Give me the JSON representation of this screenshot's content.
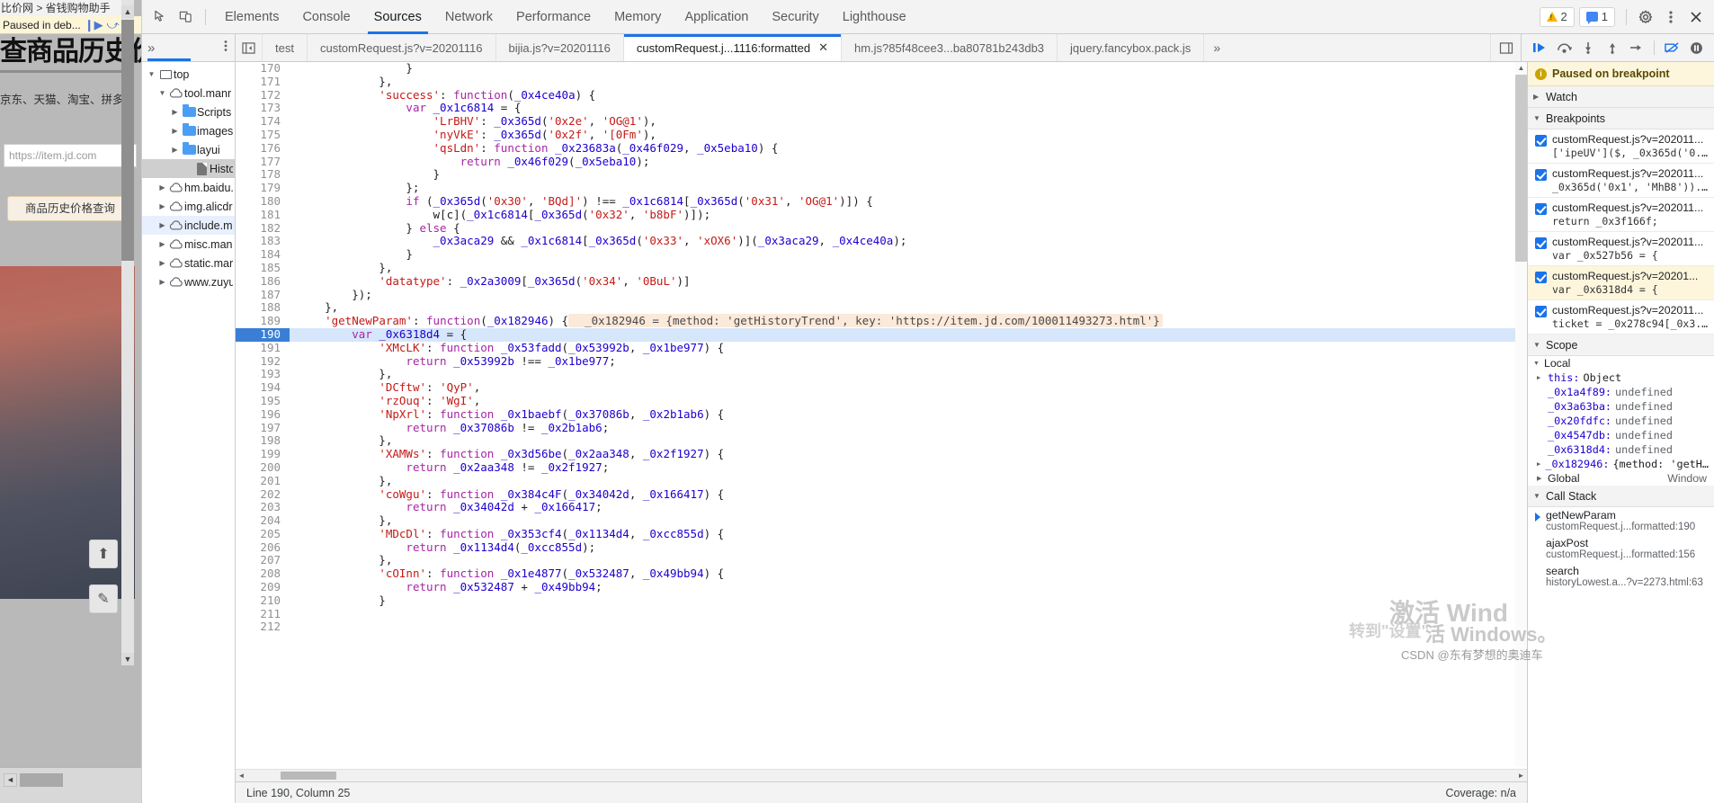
{
  "webpage": {
    "breadcrumb": "比价网 > 省钱购物助手",
    "paused_label": "Paused in deb...",
    "resume_icon": "resume-icon",
    "step_icon": "step-over-icon",
    "title": "查商品历史价",
    "subtitle": "京东、天猫、淘宝、拼多",
    "search_placeholder": "https://item.jd.com",
    "query_button": "商品历史价格查询",
    "scroll_up": "▲",
    "scroll_down": "▼",
    "hscroll_left": "◄",
    "hscroll_right": "►",
    "back_to_top_icon": "arrow-up-icon",
    "edit_icon": "pencil-icon"
  },
  "toolbar": {
    "inspect_icon": "inspect-element-icon",
    "device_icon": "device-toolbar-icon",
    "panels": [
      {
        "label": "Elements",
        "active": false
      },
      {
        "label": "Console",
        "active": false
      },
      {
        "label": "Sources",
        "active": true
      },
      {
        "label": "Network",
        "active": false
      },
      {
        "label": "Performance",
        "active": false
      },
      {
        "label": "Memory",
        "active": false
      },
      {
        "label": "Application",
        "active": false
      },
      {
        "label": "Security",
        "active": false
      },
      {
        "label": "Lighthouse",
        "active": false
      }
    ],
    "warning_count": "2",
    "message_count": "1",
    "settings_icon": "gear-icon",
    "more_icon": "kebab-menu-icon",
    "close_icon": "close-icon"
  },
  "filetabs": {
    "more_icon": "chevrons-right-icon",
    "kebab_icon": "kebab-menu-icon",
    "panel_toggle_icon": "show-navigator-icon",
    "tabs": [
      {
        "label": "test",
        "active": false,
        "closable": false
      },
      {
        "label": "customRequest.js?v=20201116",
        "active": false,
        "closable": false
      },
      {
        "label": "bijia.js?v=20201116",
        "active": false,
        "closable": false
      },
      {
        "label": "customRequest.j...1116:formatted",
        "active": true,
        "closable": true
      },
      {
        "label": "hm.js?85f48cee3...ba80781b243db3",
        "active": false,
        "closable": false
      },
      {
        "label": "jquery.fancybox.pack.js",
        "active": false,
        "closable": false
      }
    ],
    "overflow_icon": "chevrons-right-icon",
    "dock_icon": "dock-side-icon",
    "close_label": "✕"
  },
  "debug_controls": [
    {
      "name": "resume-script-execution",
      "glyph": "▶",
      "accent": true
    },
    {
      "name": "step-over-next-call",
      "glyph": "↷",
      "accent": false
    },
    {
      "name": "step-into-next-call",
      "glyph": "↓",
      "accent": false
    },
    {
      "name": "step-out-of-function",
      "glyph": "↑",
      "accent": false
    },
    {
      "name": "step",
      "glyph": "⇥",
      "accent": false
    },
    {
      "name": "deactivate-breakpoints",
      "glyph": "⤮",
      "accent": false
    },
    {
      "name": "pause-on-exceptions",
      "glyph": "⏸",
      "accent": false
    }
  ],
  "navigator": {
    "tree": [
      {
        "label": "top",
        "indent": 0,
        "twisty": "open",
        "icon": "frame",
        "state": ""
      },
      {
        "label": "tool.manr",
        "indent": 1,
        "twisty": "open",
        "icon": "cloud",
        "state": ""
      },
      {
        "label": "Scripts",
        "indent": 2,
        "twisty": "closed",
        "icon": "folder",
        "state": ""
      },
      {
        "label": "images",
        "indent": 2,
        "twisty": "closed",
        "icon": "folder",
        "state": ""
      },
      {
        "label": "layui",
        "indent": 2,
        "twisty": "closed",
        "icon": "folder",
        "state": ""
      },
      {
        "label": "History",
        "indent": 3,
        "twisty": "none",
        "icon": "file",
        "state": "selected"
      },
      {
        "label": "hm.baidu.",
        "indent": 1,
        "twisty": "closed",
        "icon": "cloud",
        "state": ""
      },
      {
        "label": "img.alicdr",
        "indent": 1,
        "twisty": "closed",
        "icon": "cloud",
        "state": ""
      },
      {
        "label": "include.m",
        "indent": 1,
        "twisty": "closed",
        "icon": "cloud",
        "state": "hl"
      },
      {
        "label": "misc.man",
        "indent": 1,
        "twisty": "closed",
        "icon": "cloud",
        "state": ""
      },
      {
        "label": "static.mar",
        "indent": 1,
        "twisty": "closed",
        "icon": "cloud",
        "state": ""
      },
      {
        "label": "www.zuyu",
        "indent": 1,
        "twisty": "closed",
        "icon": "cloud",
        "state": ""
      }
    ]
  },
  "editor": {
    "lines": [
      {
        "n": "170",
        "code": "                }"
      },
      {
        "n": "171",
        "code": "            },"
      },
      {
        "n": "172",
        "code": "            'success': function(_0x4ce40a) {"
      },
      {
        "n": "173",
        "code": "                var _0x1c6814 = {"
      },
      {
        "n": "174",
        "code": "                    'LrBHV': _0x365d('0x2e', 'OG@1'),"
      },
      {
        "n": "175",
        "code": "                    'nyVkE': _0x365d('0x2f', '[0Fm'),"
      },
      {
        "n": "176",
        "code": "                    'qsLdn': function _0x23683a(_0x46f029, _0x5eba10) {"
      },
      {
        "n": "177",
        "code": "                        return _0x46f029(_0x5eba10);"
      },
      {
        "n": "178",
        "code": "                    }"
      },
      {
        "n": "179",
        "code": "                };"
      },
      {
        "n": "180",
        "code": "                if (_0x365d('0x30', 'BQd]') !== _0x1c6814[_0x365d('0x31', 'OG@1')]) {"
      },
      {
        "n": "181",
        "code": "                    w[c](_0x1c6814[_0x365d('0x32', 'b8bF')]);"
      },
      {
        "n": "182",
        "code": "                } else {"
      },
      {
        "n": "183",
        "code": "                    _0x3aca29 && _0x1c6814[_0x365d('0x33', 'xOX6')](_0x3aca29, _0x4ce40a);"
      },
      {
        "n": "184",
        "code": "                }"
      },
      {
        "n": "185",
        "code": "            },"
      },
      {
        "n": "186",
        "code": "            'datatype': _0x2a3009[_0x365d('0x34', '0BuL')]"
      },
      {
        "n": "187",
        "code": "        });"
      },
      {
        "n": "188",
        "code": "    },"
      },
      {
        "n": "189",
        "code": "    'getNewParam': function(_0x182946) {",
        "inline_eval": "_0x182946 = {method: 'getHistoryTrend', key: 'https://item.jd.com/100011493273.html'}"
      },
      {
        "n": "190",
        "code": "        var _0x6318d4 = {",
        "executing": true
      },
      {
        "n": "191",
        "code": "            'XMcLK': function _0x53fadd(_0x53992b, _0x1be977) {"
      },
      {
        "n": "192",
        "code": "                return _0x53992b !== _0x1be977;"
      },
      {
        "n": "193",
        "code": "            },"
      },
      {
        "n": "194",
        "code": "            'DCftw': 'QyP',"
      },
      {
        "n": "195",
        "code": "            'rzOuq': 'WgI',"
      },
      {
        "n": "196",
        "code": "            'NpXrl': function _0x1baebf(_0x37086b, _0x2b1ab6) {"
      },
      {
        "n": "197",
        "code": "                return _0x37086b != _0x2b1ab6;"
      },
      {
        "n": "198",
        "code": "            },"
      },
      {
        "n": "199",
        "code": "            'XAMWs': function _0x3d56be(_0x2aa348, _0x2f1927) {"
      },
      {
        "n": "200",
        "code": "                return _0x2aa348 != _0x2f1927;"
      },
      {
        "n": "201",
        "code": "            },"
      },
      {
        "n": "202",
        "code": "            'coWgu': function _0x384c4F(_0x34042d, _0x166417) {"
      },
      {
        "n": "203",
        "code": "                return _0x34042d + _0x166417;"
      },
      {
        "n": "204",
        "code": "            },"
      },
      {
        "n": "205",
        "code": "            'MDcDl': function _0x353cf4(_0x1134d4, _0xcc855d) {"
      },
      {
        "n": "206",
        "code": "                return _0x1134d4(_0xcc855d);"
      },
      {
        "n": "207",
        "code": "            },"
      },
      {
        "n": "208",
        "code": "            'cOInn': function _0x1e4877(_0x532487, _0x49bb94) {"
      },
      {
        "n": "209",
        "code": "                return _0x532487 + _0x49bb94;"
      },
      {
        "n": "210",
        "code": "            }"
      },
      {
        "n": "211",
        "code": ""
      },
      {
        "n": "212",
        "code": ""
      }
    ],
    "status_left": "Line 190, Column 25",
    "status_right": "Coverage: n/a"
  },
  "debugger": {
    "paused_banner": "Paused on breakpoint",
    "info_glyph": "i",
    "watch_label": "Watch",
    "breakpoints_label": "Breakpoints",
    "breakpoints": [
      {
        "file": "customRequest.js?v=202011...",
        "code": "['ipeUV']($, _0x365d('0...",
        "checked": true,
        "active": false
      },
      {
        "file": "customRequest.js?v=202011...",
        "code": "_0x365d('0x1', 'MhB8'))...",
        "checked": true,
        "active": false
      },
      {
        "file": "customRequest.js?v=202011...",
        "code": "return _0x3f166f;",
        "checked": true,
        "active": false
      },
      {
        "file": "customRequest.js?v=202011...",
        "code": "var _0x527b56 = {",
        "checked": true,
        "active": false
      },
      {
        "file": "customRequest.js?v=20201...",
        "code": "var _0x6318d4 = {",
        "checked": true,
        "active": true
      },
      {
        "file": "customRequest.js?v=202011...",
        "code": "ticket = _0x278c94[_0x3...",
        "checked": true,
        "active": false
      }
    ],
    "scope_label": "Scope",
    "local_label": "Local",
    "scope_items": [
      {
        "key": "this:",
        "value": "Object",
        "expandable": true,
        "type": "obj"
      },
      {
        "key": "_0x1a4f89:",
        "value": "undefined",
        "expandable": false,
        "type": "undef"
      },
      {
        "key": "_0x3a63ba:",
        "value": "undefined",
        "expandable": false,
        "type": "undef"
      },
      {
        "key": "_0x20fdfc:",
        "value": "undefined",
        "expandable": false,
        "type": "undef"
      },
      {
        "key": "_0x4547db:",
        "value": "undefined",
        "expandable": false,
        "type": "undef"
      },
      {
        "key": "_0x6318d4:",
        "value": "undefined",
        "expandable": false,
        "type": "undef"
      },
      {
        "key": "_0x182946:",
        "value": "{method: 'getH…",
        "expandable": true,
        "type": "obj"
      }
    ],
    "global_label": "Global",
    "global_value": "Window",
    "callstack_label": "Call Stack",
    "callstack": [
      {
        "name": "getNewParam",
        "loc": "customRequest.j...formatted:190",
        "current": true
      },
      {
        "name": "ajaxPost",
        "loc": "customRequest.j...formatted:156",
        "current": false
      },
      {
        "name": "search",
        "loc": "historyLowest.a...?v=2273.html:63",
        "current": false
      }
    ]
  },
  "watermarks": {
    "line1": "激活 Wind",
    "line2": "转到\"设置\"",
    "line3": "活 Windows。",
    "csdn": "CSDN @东有梦想的奥迪车"
  }
}
